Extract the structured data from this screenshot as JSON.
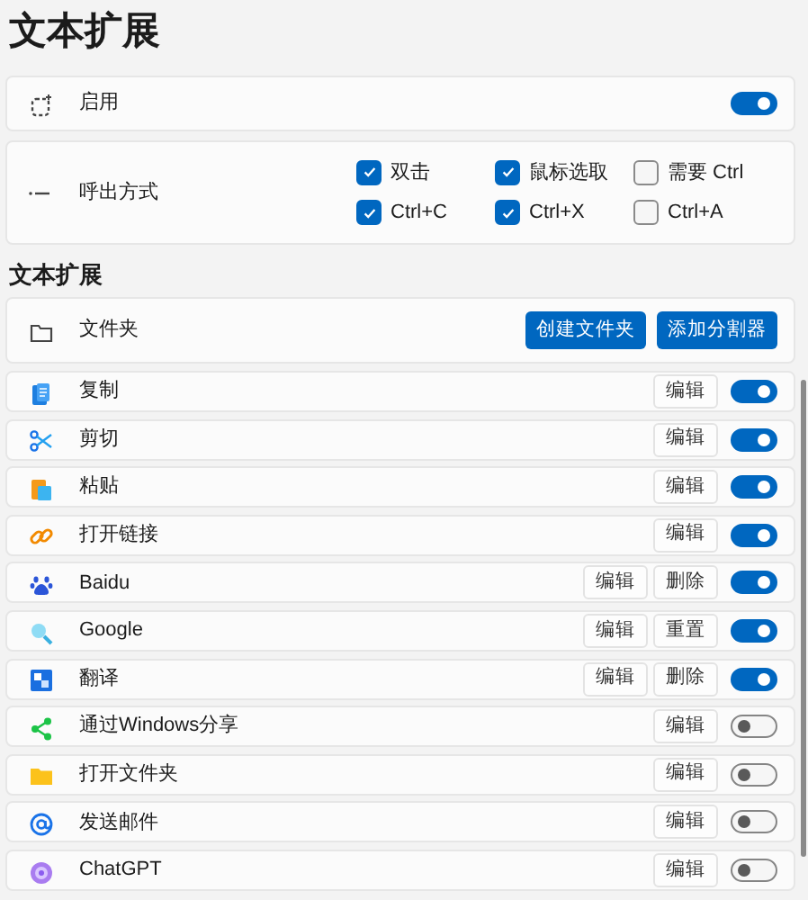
{
  "title": "文本扩展",
  "enable": {
    "label": "启用",
    "on": true
  },
  "invoke": {
    "label": "呼出方式",
    "options": [
      {
        "label": "双击",
        "checked": true
      },
      {
        "label": "鼠标选取",
        "checked": true
      },
      {
        "label": "需要 Ctrl",
        "checked": false
      },
      {
        "label": "Ctrl+C",
        "checked": true
      },
      {
        "label": "Ctrl+X",
        "checked": true
      },
      {
        "label": "Ctrl+A",
        "checked": false
      }
    ]
  },
  "section_title": "文本扩展",
  "folder": {
    "label": "文件夹",
    "buttons": [
      "创建文件夹",
      "添加分割器"
    ]
  },
  "items": [
    {
      "label": "复制",
      "buttons": [
        "编辑"
      ],
      "on": true
    },
    {
      "label": "剪切",
      "buttons": [
        "编辑"
      ],
      "on": true
    },
    {
      "label": "粘贴",
      "buttons": [
        "编辑"
      ],
      "on": true
    },
    {
      "label": "打开链接",
      "buttons": [
        "编辑"
      ],
      "on": true
    },
    {
      "label": "Baidu",
      "buttons": [
        "编辑",
        "删除"
      ],
      "on": true
    },
    {
      "label": "Google",
      "buttons": [
        "编辑",
        "重置"
      ],
      "on": true
    },
    {
      "label": "翻译",
      "buttons": [
        "编辑",
        "删除"
      ],
      "on": true
    },
    {
      "label": "通过Windows分享",
      "buttons": [
        "编辑"
      ],
      "on": false
    },
    {
      "label": "打开文件夹",
      "buttons": [
        "编辑"
      ],
      "on": false
    },
    {
      "label": "发送邮件",
      "buttons": [
        "编辑"
      ],
      "on": false
    },
    {
      "label": "ChatGPT",
      "buttons": [
        "编辑"
      ],
      "on": false
    }
  ]
}
